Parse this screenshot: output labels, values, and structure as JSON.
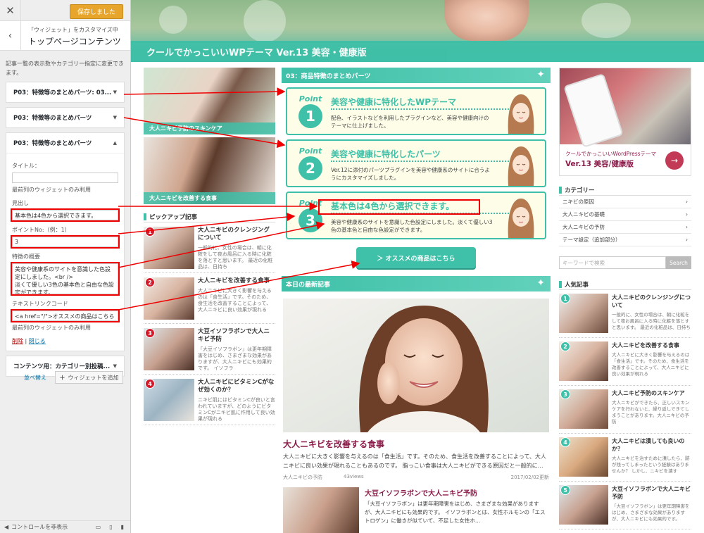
{
  "customizer": {
    "close_icon": "close-icon",
    "saved_label": "保存しました",
    "breadcrumb": "「ウィジェット」をカスタマイズ中",
    "panel_title": "トップページコンテンツ",
    "description": "記事一覧の表示数やカテゴリー指定に変更できます。",
    "widgets": [
      {
        "title": "P03：特徴等のまとめパーツ: 03..."
      },
      {
        "title": "P03：特徴等のまとめパーツ"
      },
      {
        "title": "P03：特徴等のまとめパーツ"
      },
      {
        "title": "コンテンツ用：カテゴリー別投稿..."
      }
    ],
    "form": {
      "title_label": "タイトル：",
      "title_value": "",
      "title_note": "最前列のウィジェットのみ利用",
      "heading_label": "見出し",
      "heading_value": "基本色は4色から選択できます。",
      "point_label": "ポイントNo:（例：1）",
      "point_value": "3",
      "summary_label": "特徴の概要",
      "summary_value": "美容や健康系のサイトを意識した色設定にしました。<br />\n淡くて優しい3色の基本色と自由な色設定ができます。",
      "link_label": "テキストリンクコード",
      "link_value": "<a href=\"/\">オススメの商品はこちら",
      "link_note": "最前列のウィジェットのみ利用",
      "delete_label": "削除",
      "separator": "|",
      "close_label": "閉じる"
    },
    "reorder_label": "並べ替え",
    "add_widget_label": "ウィジェットを追加",
    "hide_controls_label": "コントロールを非表示"
  },
  "site": {
    "title": "クールでかっこいいWPテーマ Ver.13 美容・健康版",
    "banners": [
      {
        "caption": "大人ニキビ予防のスキンケア"
      },
      {
        "caption": "大人ニキビを改善する食事"
      }
    ],
    "pickup": {
      "heading": "ピックアップ記事",
      "items": [
        {
          "num": "1",
          "title": "大人ニキビのクレンジングについて",
          "excerpt": "一般的に、女性の場合は、朝に化粧をして夜お風呂に入る時に化粧を落とすと思います。 最近の化粧品は、日持ち"
        },
        {
          "num": "2",
          "title": "大人ニキビを改善する食事",
          "excerpt": "大人ニキビに大きく影響を与えるのは「食生活」です。そのため、食生活を改善することによって、大人ニキビに良い効果が現れる"
        },
        {
          "num": "3",
          "title": "大豆イソフラボンで大人ニキビ予防",
          "excerpt": "「大豆イソフラボン」は更年期障害をはじめ、さまざまな効果がありますが、大人ニキビにも効果的です。 イソフラ"
        },
        {
          "num": "4",
          "title": "大人ニキビにビタミンCがなぜ効くのか？",
          "excerpt": "ニキビ肌にはビタミンCが良いと言われていますが、どのようにビタミンCがニキビ肌に作用して良い効果が現れる"
        }
      ]
    },
    "features": {
      "section_title": "03：商品特徴のまとめパーツ",
      "point_word": "Point",
      "items": [
        {
          "num": "1",
          "title": "美容や健康に特化したWPテーマ",
          "desc": "配色、イラストなどを利用したプラグインなど、美容や健康向けのテーマに仕上げました。"
        },
        {
          "num": "2",
          "title": "美容や健康に特化したパーツ",
          "desc": "Ver.12に添付のパーツプラグインを美容や健康系のサイトに合うようにカスタマイズしました。"
        },
        {
          "num": "3",
          "title": "基本色は4色から選択できます。",
          "desc": "美容や健康系のサイトを意識した色設定にしました。淡くて優しい3色の基本色と自由な色設定ができます。"
        }
      ],
      "cta_label": "＞ オススメの商品はこちら"
    },
    "latest": {
      "section_title": "本日の最新記事",
      "featured": {
        "title": "大人ニキビを改善する食事",
        "excerpt": "大人ニキビに大きく影響を与えるのは「食生活」です。そのため、食生活を改善することによって、大人ニキビに良い効果が現れることもあるのです。 脂っこい食事は大人ニキビができる原因だと一般的に…",
        "category": "大人ニキビの予防",
        "views": "43views",
        "date": "2017/02/02更新"
      },
      "second": {
        "title": "大豆イソフラボンで大人ニキビ予防",
        "excerpt": "「大豆イソフラボン」は更年期障害をはじめ、さまざまな効果がありますが、大人ニキビにも効果的です。 イソフラボンとは、女性ホルモンの「エストロゲン」に働きが似ていて、不足した女性ホ…"
      }
    },
    "ad": {
      "line1": "クールでかっこいいWordPressテーマ",
      "line2": "Ver.13 美容/健康版",
      "go_icon": "arrow-right-icon"
    },
    "categories": {
      "heading": "カテゴリー",
      "items": [
        "ニキビの原因",
        "大人ニキビの基礎",
        "大人ニキビの予防",
        "テーマ設定（追加部分）"
      ]
    },
    "search": {
      "placeholder": "キーワードで検索",
      "button": "Search"
    },
    "popular": {
      "heading": "人気記事",
      "items": [
        {
          "num": "1",
          "title": "大人ニキビのクレンジングについて",
          "excerpt": "一般的に、女性の場合は、朝に化粧をして夜お風呂に入る時に化粧を落とすと思います。 最近の化粧品は、日持ち"
        },
        {
          "num": "2",
          "title": "大人ニキビを改善する食事",
          "excerpt": "大人ニキビに大きく影響を与えるのは「食生活」です。そのため、食生活を改善することによって、大人ニキビに良い効果が現れる"
        },
        {
          "num": "3",
          "title": "大人ニキビ予防のスキンケア",
          "excerpt": "大人ニキビができたら、正しいスキンケアを行わないと、繰り返しできてしまうことがあります。大人ニキビの予防"
        },
        {
          "num": "4",
          "title": "大人ニキビは潰しても良いのか？",
          "excerpt": "大人ニキビを治すために潰したら、跡が残ってしまったという経験はありませんか？ しかし、ニキビを潰す"
        },
        {
          "num": "5",
          "title": "大豆イソフラボンで大人ニキビ予防",
          "excerpt": "「大豆イソフラボン」は更年期障害をはじめ、さまざまな効果がありますが、大人ニキビにも効果的です。"
        }
      ]
    }
  },
  "colors": {
    "accent": "#3fc0a8",
    "brand": "#8b1c4a",
    "annotation": "#e00000",
    "saved": "#e7a52c"
  }
}
